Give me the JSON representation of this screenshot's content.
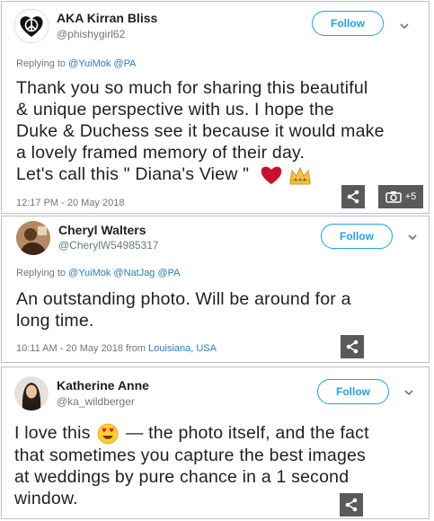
{
  "tweets": [
    {
      "name": "AKA Kirran Bliss",
      "handle": "@phishygirl62",
      "follow_label": "Follow",
      "replying_prefix": "Replying to",
      "replying_to": "@YuiMok @PA",
      "body_lines": [
        "Thank you so much for sharing this beautiful",
        "& unique perspective with us. I hope the",
        "Duke & Duchess see it because it would make",
        "a lovely framed memory of their day.",
        "Let's call this \" Diana's View \""
      ],
      "body_emoji": [
        "red-heart",
        "crown"
      ],
      "timestamp": "12:17 PM - 20 May 2018",
      "photo_count": "+5"
    },
    {
      "name": "Cheryl Walters",
      "handle": "@CherylW54985317",
      "follow_label": "Follow",
      "replying_prefix": "Replying to",
      "replying_to": "@YuiMok @NatJag @PA",
      "body_lines": [
        "An outstanding photo. Will be around for a",
        "long time."
      ],
      "timestamp": "10:11 AM - 20 May 2018 from",
      "location": "Louisiana, USA"
    },
    {
      "name": "Katherine Anne",
      "handle": "@ka_wildberger",
      "follow_label": "Follow",
      "body_lines": [
        "I love this",
        "— the photo itself, and the fact",
        "that sometimes you capture the best images",
        "at weddings by pure chance in a 1 second",
        "window."
      ],
      "body_emoji": [
        "heart-eyes-face"
      ]
    }
  ],
  "colors": {
    "accent": "#1da1f2",
    "link": "#2b7bb9",
    "muted": "#697882",
    "text": "#1c2022",
    "button_overlay": "#5a5a5a"
  },
  "icons": [
    "peace-heart-avatar",
    "chevron-down-icon",
    "share-icon",
    "camera-icon",
    "red-heart-emoji",
    "crown-emoji",
    "heart-eyes-emoji"
  ]
}
